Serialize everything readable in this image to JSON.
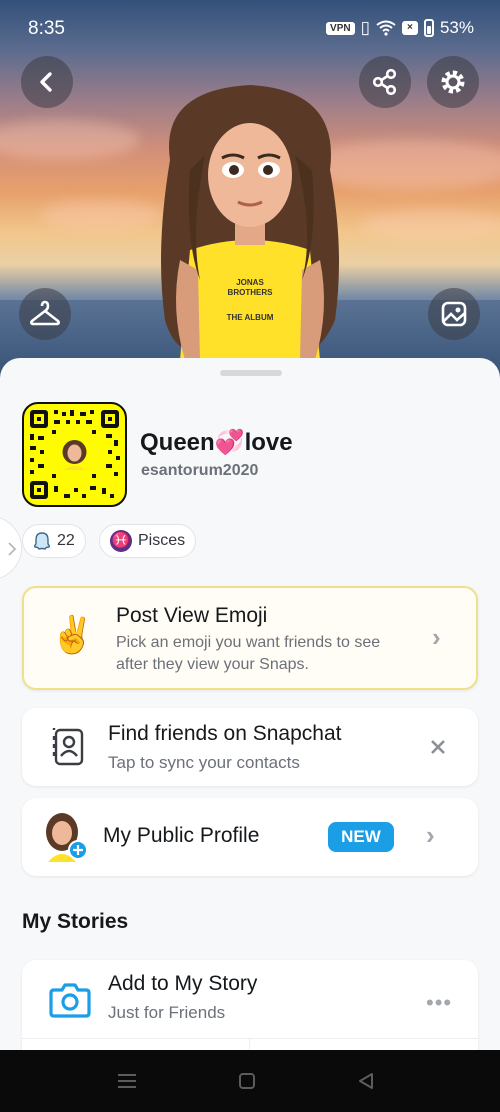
{
  "status_bar": {
    "time": "8:35",
    "vpn": "VPN",
    "battery": "53%"
  },
  "profile": {
    "display_name": "Queen💞love",
    "username": "esantorum2020",
    "friends_count": "22",
    "zodiac": "Pisces"
  },
  "post_view_emoji": {
    "emoji": "✌️",
    "title": "Post View Emoji",
    "subtitle_line1": "Pick an emoji you want friends to see",
    "subtitle_line2": "after they view your Snaps."
  },
  "find_friends": {
    "title": "Find friends on Snapchat",
    "subtitle": "Tap to sync your contacts"
  },
  "public_profile": {
    "title": "My Public Profile",
    "badge": "NEW"
  },
  "my_stories": {
    "section_title": "My Stories",
    "add_title": "Add to My Story",
    "add_subtitle": "Just for Friends"
  },
  "shirt_text": {
    "line1": "JONAS",
    "line2": "BROTHERS",
    "line3": "THE ALBUM"
  },
  "colors": {
    "snap_yellow": "#fffc00",
    "accent_blue": "#1a9ee6",
    "zodiac_purple": "#5b2e8a"
  }
}
